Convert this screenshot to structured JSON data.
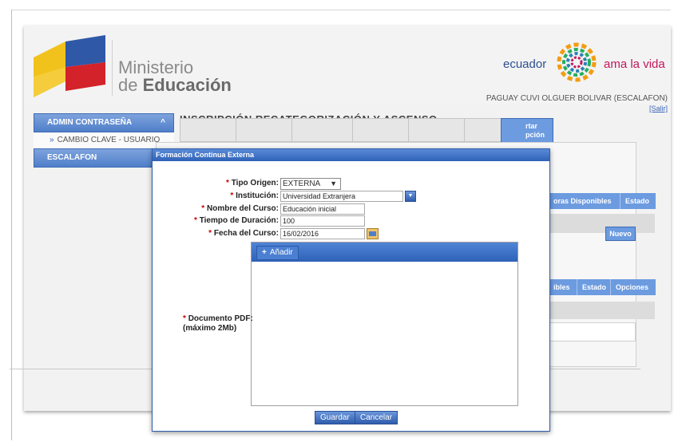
{
  "header": {
    "ministry_line1": "Ministerio",
    "ministry_line2_prefix": "de ",
    "ministry_line2_bold": "Educación",
    "brand_left": "ecuador",
    "brand_right": "ama la vida",
    "user_name": "PAGUAY CUVI OLGUER BOLIVAR (ESCALAFON)",
    "logout": "[Salir]"
  },
  "sidebar": {
    "sections": [
      {
        "label": "ADMIN CONTRASEÑA",
        "chevron": "^",
        "items": [
          "CAMBIO CLAVE - USUARIO"
        ]
      },
      {
        "label": "ESCALAFON",
        "items": []
      }
    ]
  },
  "main": {
    "title": "INSCRIPCIÓN RECATEGORIZACIÓN Y ASCENSO",
    "visible_tab_fragment": "rtar\npción",
    "table_headers_1": [
      "Horas Disponibles",
      "Estado"
    ],
    "table_headers_1_fragment": "oras Disponibles",
    "new_button": "Nuevo",
    "table_headers_2": [
      "ibles",
      "Estado",
      "Opciones"
    ]
  },
  "modal": {
    "title": "Formación Continua Externa",
    "fields": {
      "tipo_origen": {
        "label": "Tipo Origen:",
        "value": "EXTERNA"
      },
      "institucion": {
        "label": "Institución:",
        "value": "Universidad Extranjera"
      },
      "nombre_curso": {
        "label": "Nombre del Curso:",
        "value": "Educación inicial"
      },
      "tiempo_duracion": {
        "label": "Tiempo de Duración:",
        "value": "100"
      },
      "fecha_curso": {
        "label": "Fecha del Curso:",
        "value": "16/02/2016"
      }
    },
    "document_label_line1": "Documento PDF:",
    "document_label_line2": "(máximo 2Mb)",
    "add_button": "Añadir",
    "save_button": "Guardar",
    "cancel_button": "Cancelar",
    "required_mark": "*"
  },
  "colors": {
    "accent_blue": "#4f7fc9",
    "dialog_title_blue": "#2f62b8",
    "brand_pink": "#c2185b",
    "brand_navy": "#2d4f8f"
  },
  "icons": [
    "flag-logo-icon",
    "ecuador-swirl-icon",
    "chevron-up-icon",
    "dropdown-arrow-icon",
    "calendar-icon",
    "plus-icon"
  ]
}
